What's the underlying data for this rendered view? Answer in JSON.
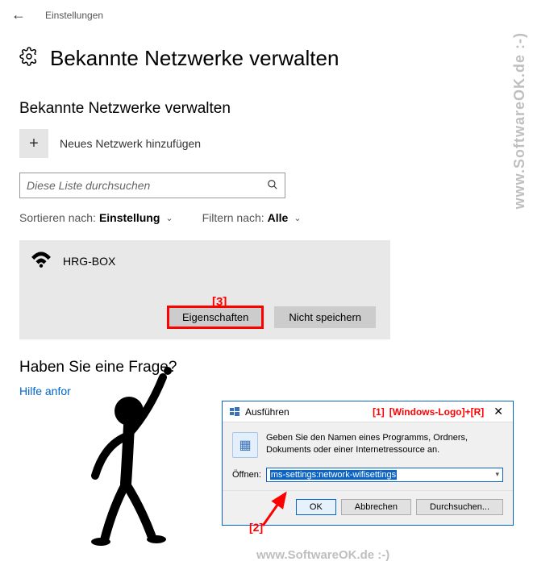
{
  "header": {
    "title": "Einstellungen"
  },
  "page": {
    "title": "Bekannte Netzwerke verwalten"
  },
  "section": {
    "title": "Bekannte Netzwerke verwalten",
    "addNetwork": "Neues Netzwerk hinzufügen",
    "searchPlaceholder": "Diese Liste durchsuchen",
    "sortLabel": "Sortieren nach:",
    "sortValue": "Einstellung",
    "filterLabel": "Filtern nach:",
    "filterValue": "Alle"
  },
  "network": {
    "name": "HRG-BOX",
    "properties": "Eigenschaften",
    "forget": "Nicht speichern"
  },
  "markers": {
    "m1": "[1]",
    "m2": "[2]",
    "m3": "[3]",
    "shortcut": "[Windows-Logo]+[R]"
  },
  "question": {
    "title": "Haben Sie eine Frage?",
    "help": "Hilfe anfor"
  },
  "runDialog": {
    "title": "Ausführen",
    "desc": "Geben Sie den Namen eines Programms, Ordners, Dokuments oder einer Internetressource an.",
    "openLabel": "Öffnen:",
    "openValue": "ms-settings:network-wifisettings",
    "ok": "OK",
    "cancel": "Abbrechen",
    "browse": "Durchsuchen..."
  },
  "watermark": "www.SoftwareOK.de :-)"
}
